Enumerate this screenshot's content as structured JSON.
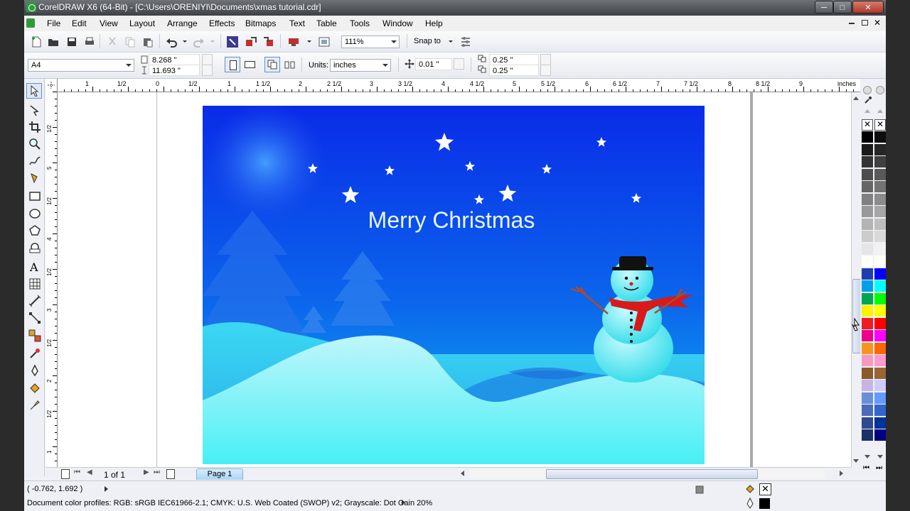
{
  "window": {
    "title": "CorelDRAW X6 (64-Bit) - [C:\\Users\\ORENIYI\\Documents\\xmas tutorial.cdr]",
    "minimize": "─",
    "maximize": "□",
    "close": "✕"
  },
  "menu": {
    "items": [
      "File",
      "Edit",
      "View",
      "Layout",
      "Arrange",
      "Effects",
      "Bitmaps",
      "Text",
      "Table",
      "Tools",
      "Window",
      "Help"
    ]
  },
  "toolbar": {
    "zoom": "111%",
    "snap_to": "Snap to"
  },
  "propertybar": {
    "page_size": "A4",
    "width": "8.268 \"",
    "height": "11.693 \"",
    "units_label": "Units:",
    "units": "inches",
    "nudge": "0.01 \"",
    "dup_x": "0.25 \"",
    "dup_y": "0.25 \""
  },
  "ruler": {
    "unit": "inches",
    "top_labels": [
      "1",
      "1/2",
      "0",
      "1/2",
      "1",
      "1 1/2",
      "2",
      "2 1/2",
      "3",
      "3 1/2",
      "4",
      "4 1/2",
      "5",
      "5 1/2",
      "6",
      "6 1/2",
      "7",
      "7 1/2",
      "8",
      "8 1/2",
      "9"
    ],
    "left_labels": [
      "1/2",
      "5",
      "1/2",
      "4",
      "1/2",
      "3",
      "1/2",
      "2",
      "1/2",
      "1",
      "1/2"
    ]
  },
  "artwork": {
    "greeting": "Merry Christmas",
    "sky_top": "#0a27e6",
    "sky_bottom": "#12b5f0",
    "snow_color": "#5ff3f6",
    "scarf_color": "#d81a1a"
  },
  "pagenav": {
    "page_count": "1 of 1",
    "page_tab": "Page 1"
  },
  "status": {
    "coords": "( -0.762, 1.692 )",
    "color_profiles": "Document color profiles: RGB: sRGB IEC61966-2.1; CMYK: U.S. Web Coated (SWOP) v2; Grayscale: Dot Gain 20%"
  },
  "palette": {
    "col1": [
      "#000000",
      "#1a1a1a",
      "#333333",
      "#4d4d4d",
      "#666666",
      "#808080",
      "#999999",
      "#b3b3b3",
      "#cccccc",
      "#e6e6e6",
      "#ffffff",
      "#1f3fb0",
      "#00a0e9",
      "#00a651",
      "#fff200",
      "#ed1c24",
      "#ec008c",
      "#f7941d",
      "#f49ac1",
      "#8b5a2b",
      "#c7b3e5",
      "#6a8fd8",
      "#4c6ab8",
      "#2d4a8f",
      "#1b2f6b"
    ],
    "col2": [
      "#0d0d0d",
      "#262626",
      "#404040",
      "#595959",
      "#737373",
      "#8c8c8c",
      "#a6a6a6",
      "#bfbfbf",
      "#d9d9d9",
      "#f2f2f2",
      "#ffffff",
      "#0000ff",
      "#00ffff",
      "#00ff00",
      "#ffff00",
      "#ff0000",
      "#ff00ff",
      "#ff6600",
      "#ff99cc",
      "#996633",
      "#ccccff",
      "#6699ff",
      "#3366cc",
      "#003399",
      "#000080"
    ]
  }
}
